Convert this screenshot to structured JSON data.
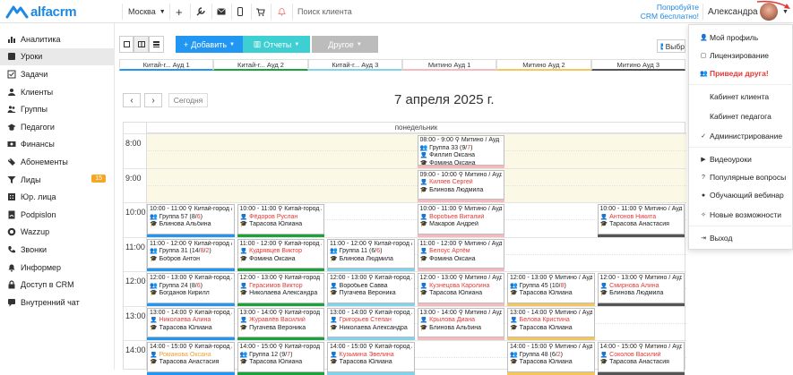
{
  "header": {
    "logo_text": "alfacrm",
    "city": "Москва",
    "search_placeholder": "Поиск клиента",
    "promo_line1": "Попробуйте",
    "promo_line2": "CRM бесплатно!",
    "user_name": "Александра"
  },
  "sidebar": {
    "items": [
      {
        "label": "Аналитика",
        "icon": "chart-icon"
      },
      {
        "label": "Уроки",
        "icon": "book-icon",
        "active": true
      },
      {
        "label": "Задачи",
        "icon": "tasks-icon"
      },
      {
        "label": "Клиенты",
        "icon": "user-icon"
      },
      {
        "label": "Группы",
        "icon": "group-icon"
      },
      {
        "label": "Педагоги",
        "icon": "teacher-icon"
      },
      {
        "label": "Финансы",
        "icon": "finance-icon"
      },
      {
        "label": "Абонементы",
        "icon": "ticket-icon"
      },
      {
        "label": "Лиды",
        "icon": "funnel-icon",
        "badge": "15"
      },
      {
        "label": "Юр. лица",
        "icon": "company-icon"
      },
      {
        "label": "Podpislon",
        "icon": "sign-icon"
      },
      {
        "label": "Wazzup",
        "icon": "chat-icon"
      },
      {
        "label": "Звонки",
        "icon": "phone-icon"
      },
      {
        "label": "Информер",
        "icon": "bell-icon"
      },
      {
        "label": "Доступ в CRM",
        "icon": "lock-icon"
      },
      {
        "label": "Внутренний чат",
        "icon": "message-icon"
      }
    ]
  },
  "toolbar": {
    "add_label": "Добавить",
    "reports_label": "Отчеты",
    "other_label": "Другое",
    "chip_label": "Выбр"
  },
  "rooms": [
    {
      "label": "Китай-г... Ауд 1",
      "color": "#2196f3"
    },
    {
      "label": "Китай-г... Ауд 2",
      "color": "#1aa33a"
    },
    {
      "label": "Китай-г... Ауд 3",
      "color": "#7fd3ea"
    },
    {
      "label": "Митино Ауд 1",
      "color": "#f6b9be"
    },
    {
      "label": "Митино Ауд 2",
      "color": "#f5c75a"
    },
    {
      "label": "Митино Ауд 3",
      "color": "#555555"
    }
  ],
  "calendar": {
    "prev_label": "‹",
    "next_label": "›",
    "today_label": "Сегодня",
    "date_title": "7 апреля 2025 г.",
    "day_label": "понедельник",
    "hours": [
      "8:00",
      "9:00",
      "10:00",
      "11:00",
      "12:00",
      "13:00",
      "14:00"
    ]
  },
  "events": [
    {
      "time": "08:00 - 9:00 ⚲ Митино / Ауд 1",
      "group": "Группа 33 (",
      "count_a": "9",
      "count_b": "7",
      "person": "Филлип Оксана",
      "teacher": "Фомина Оксана",
      "col": 3,
      "start": 0,
      "person_red": false,
      "group_line": true
    },
    {
      "time": "09:00 - 10:00 ⚲ Митино / Ауд 1",
      "person": "Киляев Сергей",
      "teacher": "Блинова Людмила",
      "col": 3,
      "start": 1,
      "person_red": true,
      "group_line": false
    },
    {
      "time": "10:00 - 11:00 ⚲ Китай-город / Ауд 1",
      "group": "Группа 57 (",
      "count_a": "8",
      "count_b": "6",
      "teacher": "Блинова Альбина",
      "col": 0,
      "start": 2,
      "group_line": true
    },
    {
      "time": "10:00 - 11:00 ⚲ Китай-город / Ауд 2",
      "person": "Фёдоров Руслан",
      "teacher": "Тарасова Юлиана",
      "col": 1,
      "start": 2,
      "person_red": true,
      "group_line": false
    },
    {
      "time": "10:00 - 11:00 ⚲ Митино / Ауд 1",
      "person": "Воробьев Виталий",
      "teacher": "Макаров Андрей",
      "col": 3,
      "start": 2,
      "person_red": true,
      "group_line": false
    },
    {
      "time": "10:00 - 11:00 ⚲ Митино / Ауд 3",
      "person": "Антонов Никита",
      "teacher": "Тарасова Анастасия",
      "col": 5,
      "start": 2,
      "person_red": true,
      "group_line": false
    },
    {
      "time": "11:00 - 12:00 ⚲ Китай-город / Ауд 1",
      "group": "Группа 31 (",
      "count_a": "14",
      "count_b": "8",
      "count_c": "2",
      "teacher": "Бобров Антон",
      "col": 0,
      "start": 3,
      "group_line": true
    },
    {
      "time": "11:00 - 12:00 ⚲ Китай-город / Ауд 2",
      "person": "Кудрявцев Виктор",
      "teacher": "Фомина Оксана",
      "col": 1,
      "start": 3,
      "person_red": true,
      "group_line": false
    },
    {
      "time": "11:00 - 12:00 ⚲ Китай-город / Ауд 3",
      "group": "Группа 11 (",
      "count_a": "6",
      "count_b": "6",
      "teacher": "Блинова Людмила",
      "col": 2,
      "start": 3,
      "group_line": true
    },
    {
      "time": "11:00 - 12:00 ⚲ Митино / Ауд 1",
      "person": "Белоус Артём",
      "teacher": "Фомина Оксана",
      "col": 3,
      "start": 3,
      "person_red": true,
      "group_line": false
    },
    {
      "time": "12:00 - 13:00 ⚲ Китай-город / Ауд 1",
      "group": "Группа 24 (",
      "count_a": "8",
      "count_b": "6",
      "teacher": "Богданов Кирилл",
      "col": 0,
      "start": 4,
      "group_line": true
    },
    {
      "time": "12:00 - 13:00 ⚲ Китай-город / Ауд 2",
      "person": "Герасимов Виктор",
      "teacher": "Николаева Александра",
      "col": 1,
      "start": 4,
      "person_red": true,
      "group_line": false
    },
    {
      "time": "12:00 - 13:00 ⚲ Китай-город / Ауд 3",
      "person": "Воробьев Савва",
      "teacher": "Пугачева Вероника",
      "col": 2,
      "start": 4,
      "person_red": false,
      "group_line": false
    },
    {
      "time": "12:00 - 13:00 ⚲ Митино / Ауд 1",
      "person": "Кузнецова Каролина",
      "teacher": "Тарасова Юлиана",
      "col": 3,
      "start": 4,
      "person_red": true,
      "group_line": false
    },
    {
      "time": "12:00 - 13:00 ⚲ Митино / Ауд",
      "group": "Группа 45 (",
      "count_a": "10",
      "count_b": "8",
      "teacher": "Тарасова Юлиана",
      "col": 4,
      "start": 4,
      "group_line": true
    },
    {
      "time": "12:00 - 13:00 ⚲ Митино / Ауд",
      "person": "Смирнова Алина",
      "teacher": "Блинова Людмила",
      "col": 5,
      "start": 4,
      "person_red": true,
      "group_line": false
    },
    {
      "time": "13:00 - 14:00 ⚲ Китай-город / Ауд 1",
      "person": "Николаева Алина",
      "teacher": "Тарасова Юлиана",
      "col": 0,
      "start": 5,
      "person_red": true,
      "group_line": false
    },
    {
      "time": "13:00 - 14:00 ⚲ Китай-город / Ауд 2",
      "person": "Журавлёв Василий",
      "teacher": "Пугачева Вероника",
      "col": 1,
      "start": 5,
      "person_red": true,
      "group_line": false
    },
    {
      "time": "13:00 - 14:00 ⚲ Китай-город / Ауд 3",
      "person": "Григорьев Степан",
      "teacher": "Николаева Александра",
      "col": 2,
      "start": 5,
      "person_red": true,
      "group_line": false
    },
    {
      "time": "13:00 - 14:00 ⚲ Митино / Ауд 1",
      "person": "Крылова Диана",
      "teacher": "Блинова Альбина",
      "col": 3,
      "start": 5,
      "person_red": true,
      "group_line": false
    },
    {
      "time": "13:00 - 14:00 ⚲ Митино / Ауд",
      "person": "Белова Кристина",
      "teacher": "Тарасова Юлиана",
      "col": 4,
      "start": 5,
      "person_red": true,
      "group_line": false
    },
    {
      "time": "14:00 - 15:00 ⚲ Китай-город / Ауд 1",
      "person": "Романова Оксана",
      "teacher": "Тарасова Анастасия",
      "col": 0,
      "start": 6,
      "person_red": true,
      "group_line": false,
      "person_orange": true
    },
    {
      "time": "14:00 - 15:00 ⚲ Китай-город / Ауд 2",
      "group": "Группа 12 (",
      "count_a": "9",
      "count_b": "7",
      "teacher": "Тарасова Юлиана",
      "col": 1,
      "start": 6,
      "group_line": true
    },
    {
      "time": "14:00 - 15:00 ⚲ Китай-город / Ауд 3",
      "person": "Кузьмина Эвелина",
      "teacher": "Тарасова Юлиана",
      "col": 2,
      "start": 6,
      "person_red": true,
      "group_line": false
    },
    {
      "time": "14:00 - 15:00 ⚲ Митино / Ауд",
      "group": "Группа 48 (",
      "count_a": "6",
      "count_b": "2",
      "teacher": "Тарасова Юлиана",
      "col": 4,
      "start": 6,
      "group_line": true
    },
    {
      "time": "14:00 - 15:00 ⚲ Митино / Ауд",
      "person": "Соколов Василий",
      "teacher": "Тарасова Анастасия",
      "col": 5,
      "start": 6,
      "person_red": true,
      "group_line": false
    }
  ],
  "user_menu": {
    "items": [
      {
        "label": "Мой профиль",
        "icon": "user-icon"
      },
      {
        "label": "Лицензирование",
        "icon": "document-icon"
      },
      {
        "label": "Приведи друга!",
        "icon": "people-icon",
        "highlight": true
      },
      {
        "label": "Кабинет клиента",
        "icon": ""
      },
      {
        "label": "Кабинет педагога",
        "icon": ""
      },
      {
        "label": "Администрирование",
        "icon": "check-icon"
      },
      {
        "label": "Видеоуроки",
        "icon": "video-icon"
      },
      {
        "label": "Популярные вопросы",
        "icon": "question-icon"
      },
      {
        "label": "Обучающий вебинар",
        "icon": "webinar-icon"
      },
      {
        "label": "Новые возможности",
        "icon": "sparkle-icon"
      },
      {
        "label": "Выход",
        "icon": "logout-icon"
      }
    ]
  },
  "colors": {
    "accent": "#2196f3",
    "teal": "#3dcfd1",
    "red_text": "#e53935",
    "badge": "#f5a623",
    "off_hours": "#fbf9e5"
  }
}
